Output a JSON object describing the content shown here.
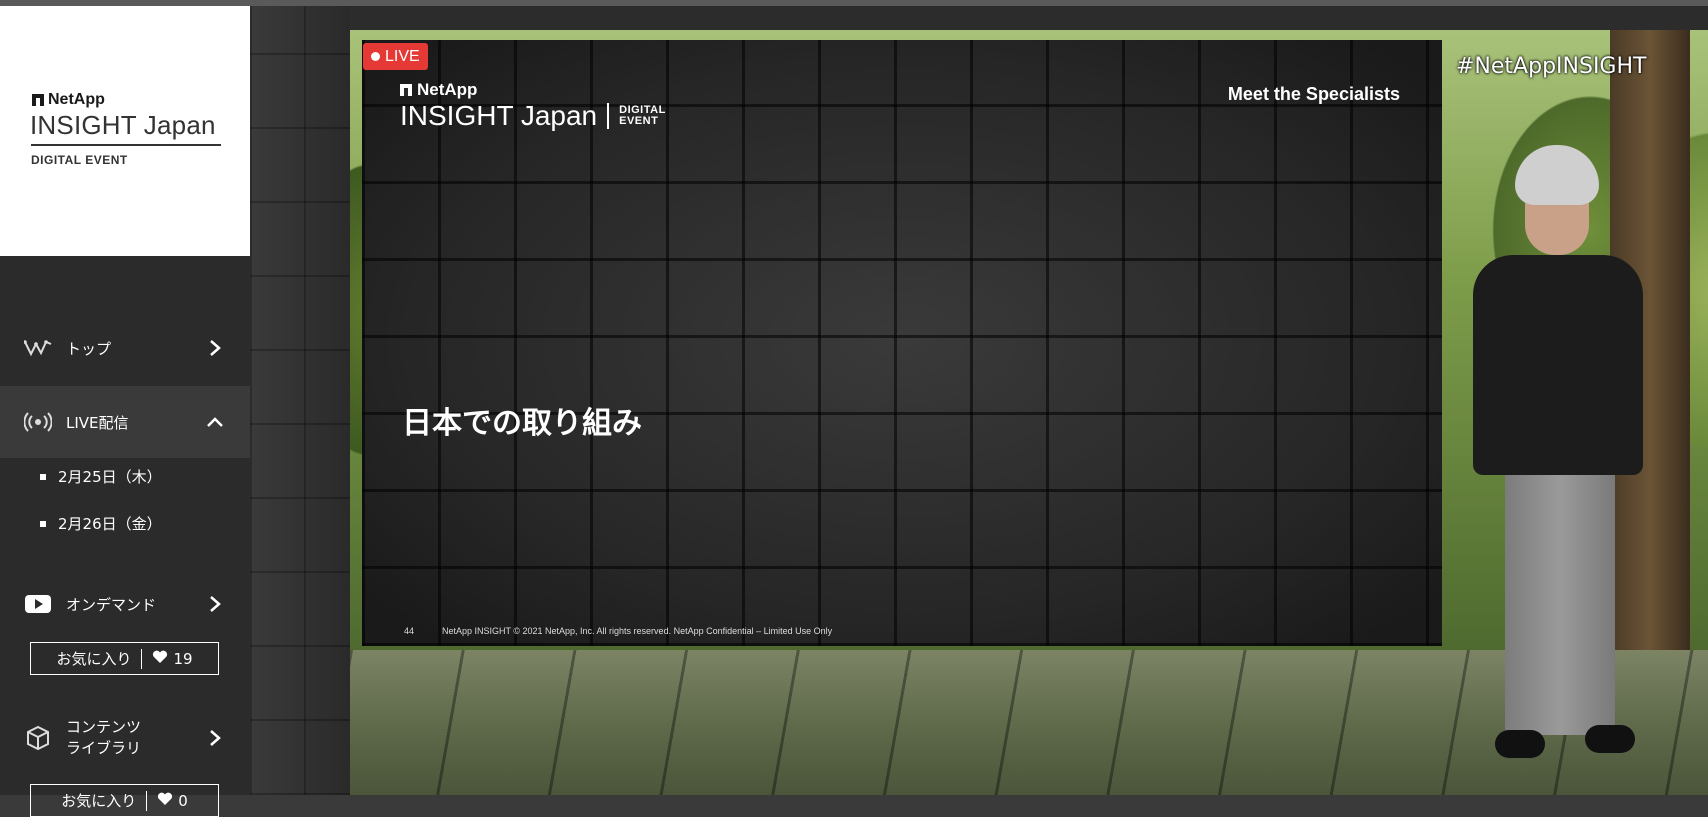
{
  "sidebar": {
    "logo": {
      "brand": "NetApp",
      "product": "INSIGHT Japan",
      "subtitle": "DIGITAL EVENT"
    },
    "nav": {
      "top": {
        "label": "トップ",
        "icon": "activity-icon"
      },
      "live": {
        "label": "LIVE配信",
        "icon": "broadcast-icon",
        "expanded": true,
        "sub_items": [
          "2月25日（木）",
          "2月26日（金）"
        ]
      },
      "ondemand": {
        "label": "オンデマンド",
        "icon": "youtube-play-icon"
      },
      "library": {
        "label_line1": "コンテンツ",
        "label_line2": "ライブラリ",
        "icon": "cube-icon"
      }
    },
    "favorites": [
      {
        "label": "お気に入り",
        "count": "19"
      },
      {
        "label": "お気に入り",
        "count": "0"
      }
    ]
  },
  "video": {
    "live_badge": "LIVE",
    "hashtag": "#NetAppINSIGHT",
    "slide": {
      "brand": "NetApp",
      "product": "INSIGHT Japan",
      "event_line1": "DIGITAL",
      "event_line2": "EVENT",
      "heading": "Meet the Specialists",
      "title": "日本での取り組み",
      "page_number": "44",
      "footer": "NetApp INSIGHT © 2021 NetApp, Inc. All rights reserved. NetApp Confidential – Limited Use Only"
    }
  },
  "colors": {
    "live_red": "#e53935",
    "sidebar_bg": "#2b2b2b",
    "sidebar_active_bg": "#3a3a3a"
  }
}
